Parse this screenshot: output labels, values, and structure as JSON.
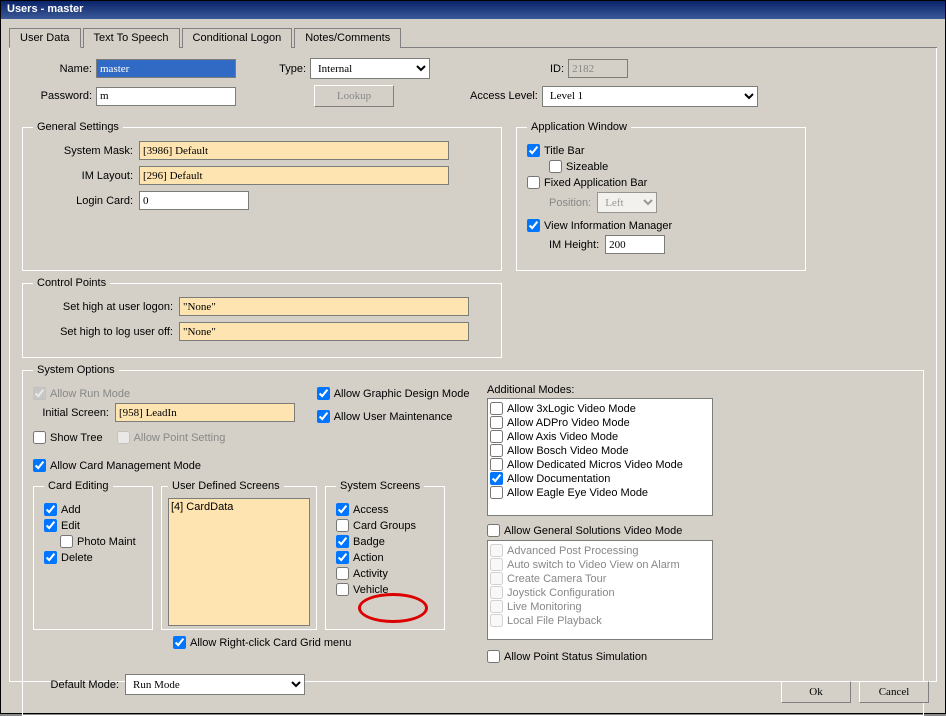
{
  "window_title": "Users - master",
  "tabs": [
    "User Data",
    "Text To Speech",
    "Conditional Logon",
    "Notes/Comments"
  ],
  "header": {
    "name_lbl": "Name:",
    "name_val": "master",
    "type_lbl": "Type:",
    "type_val": "Internal",
    "id_lbl": "ID:",
    "id_val": "2182",
    "password_lbl": "Password:",
    "password_val": "m",
    "lookup_btn": "Lookup",
    "access_lbl": "Access Level:",
    "access_val": "Level 1"
  },
  "general": {
    "legend": "General Settings",
    "mask_lbl": "System Mask:",
    "mask_val": "[3986] Default",
    "layout_lbl": "IM Layout:",
    "layout_val": "[296] Default",
    "login_lbl": "Login Card:",
    "login_val": "0"
  },
  "appwin": {
    "legend": "Application Window",
    "titlebar": "Title Bar",
    "sizeable": "Sizeable",
    "fixedbar": "Fixed Application Bar",
    "position_lbl": "Position:",
    "position_val": "Left",
    "viewim": "View Information Manager",
    "imheight_lbl": "IM Height:",
    "imheight_val": "200"
  },
  "control": {
    "legend": "Control Points",
    "logon_lbl": "Set high at user logon:",
    "logon_val": "\"None\"",
    "logoff_lbl": "Set high to log user off:",
    "logoff_val": "\"None\""
  },
  "sysopts": {
    "legend": "System Options",
    "allow_run": "Allow Run Mode",
    "initial_lbl": "Initial Screen:",
    "initial_val": "[958] LeadIn",
    "showtree": "Show Tree",
    "allow_pointset": "Allow Point Setting",
    "allow_graphic": "Allow Graphic Design Mode",
    "allow_usermaint": "Allow User Maintenance",
    "allow_cardmgmt": "Allow Card Management Mode",
    "card_editing_legend": "Card Editing",
    "add": "Add",
    "edit": "Edit",
    "photomaint": "Photo Maint",
    "delete": "Delete",
    "uds_legend": "User Defined Screens",
    "uds_item": "[4] CardData",
    "sysscreens_legend": "System Screens",
    "ss_access": "Access",
    "ss_cardgroups": "Card Groups",
    "ss_badge": "Badge",
    "ss_action": "Action",
    "ss_activity": "Activity",
    "ss_vehicle": "Vehicle",
    "allow_rightclick": "Allow Right-click Card Grid menu",
    "addmodes_lbl": "Additional Modes:",
    "addmodes": [
      {
        "txt": "Allow 3xLogic Video Mode",
        "chk": false
      },
      {
        "txt": "Allow ADPro Video Mode",
        "chk": false
      },
      {
        "txt": "Allow Axis Video Mode",
        "chk": false
      },
      {
        "txt": "Allow Bosch Video Mode",
        "chk": false
      },
      {
        "txt": "Allow Dedicated Micros Video Mode",
        "chk": false
      },
      {
        "txt": "Allow Documentation",
        "chk": true
      },
      {
        "txt": "Allow Eagle Eye Video Mode",
        "chk": false
      }
    ],
    "allow_gensol": "Allow General Solutions Video Mode",
    "gensol_items": [
      "Advanced Post Processing",
      "Auto switch to Video View on Alarm",
      "Create Camera Tour",
      "Joystick Configuration",
      "Live Monitoring",
      "Local File Playback"
    ],
    "allow_pointsim": "Allow Point Status Simulation",
    "default_mode_lbl": "Default Mode:",
    "default_mode_val": "Run Mode"
  },
  "buttons": {
    "ok": "Ok",
    "cancel": "Cancel"
  }
}
